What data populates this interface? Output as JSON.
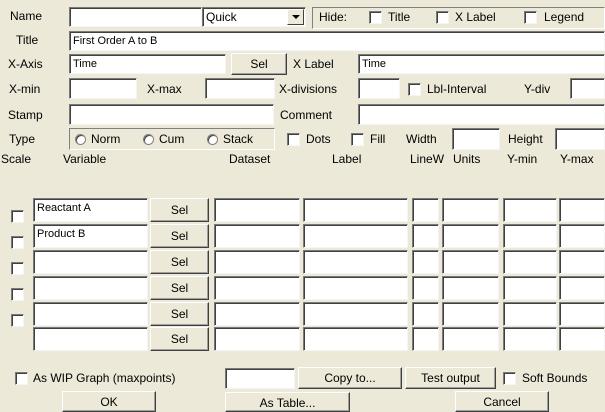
{
  "header": {
    "name_label": "Name",
    "name_value": "",
    "mode_value": "Quick",
    "hide_label": "Hide:",
    "hide_title_label": "Title",
    "hide_xlabel_label": "X Label",
    "hide_legend_label": "Legend"
  },
  "title_row": {
    "label": "Title",
    "value": "First Order A to B"
  },
  "xaxis_row": {
    "label": "X-Axis",
    "value": "Time",
    "sel_label": "Sel",
    "xlabel_label": "X Label",
    "xlabel_value": "Time"
  },
  "xmin_row": {
    "xmin_label": "X-min",
    "xmin_value": "",
    "xmax_label": "X-max",
    "xmax_value": "",
    "xdiv_label": "X-divisions",
    "xdiv_value": "",
    "lblinterval_label": "Lbl-Interval",
    "ydiv_label": "Y-div",
    "ydiv_value": ""
  },
  "stamp_row": {
    "stamp_label": "Stamp",
    "stamp_value": "",
    "comment_label": "Comment",
    "comment_value": ""
  },
  "type_row": {
    "type_label": "Type",
    "norm_label": "Norm",
    "cum_label": "Cum",
    "stack_label": "Stack",
    "dots_label": "Dots",
    "fill_label": "Fill",
    "width_label": "Width",
    "width_value": "",
    "height_label": "Height",
    "height_value": ""
  },
  "table": {
    "headers": {
      "scale": "Scale",
      "variable": "Variable",
      "dataset": "Dataset",
      "label": "Label",
      "linew": "LineW",
      "units": "Units",
      "ymin": "Y-min",
      "ymax": "Y-max"
    },
    "sel_label": "Sel",
    "rows": [
      {
        "variable": "Reactant A"
      },
      {
        "variable": "Product B"
      },
      {
        "variable": ""
      },
      {
        "variable": ""
      },
      {
        "variable": ""
      },
      {
        "variable": ""
      }
    ]
  },
  "footer": {
    "wip_label": "As WIP Graph (maxpoints)",
    "wip_value": "",
    "copy_label": "Copy to...",
    "test_label": "Test output",
    "soft_label": "Soft Bounds",
    "ok_label": "OK",
    "table_label": "As Table...",
    "cancel_label": "Cancel"
  }
}
